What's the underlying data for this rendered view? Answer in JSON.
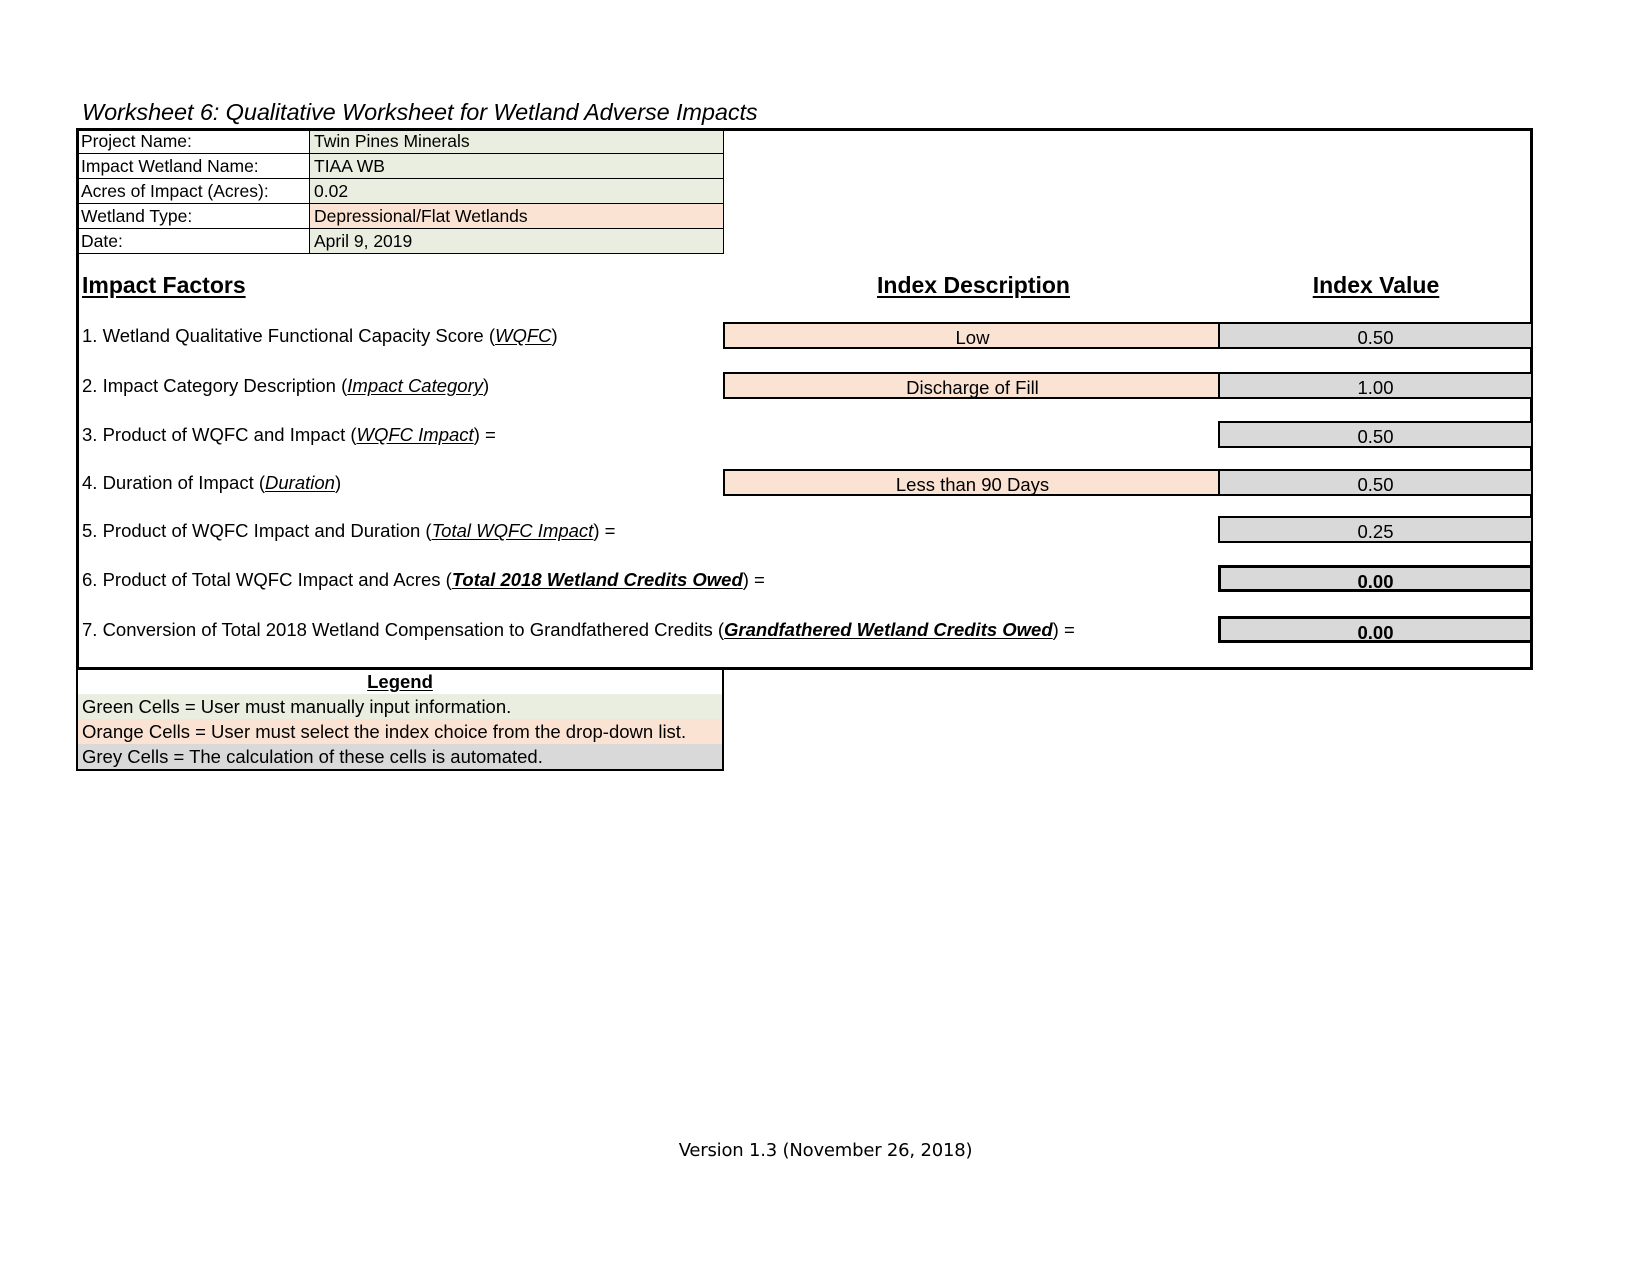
{
  "title": "Worksheet 6:  Qualitative Worksheet for Wetland Adverse Impacts",
  "project_info": {
    "rows": [
      {
        "label": "Project Name:",
        "value": "Twin Pines Minerals",
        "fill": "green"
      },
      {
        "label": "Impact Wetland Name:",
        "value": "TIAA WB",
        "fill": "green"
      },
      {
        "label": "Acres of Impact (Acres):",
        "value": "0.02",
        "fill": "green"
      },
      {
        "label": "Wetland Type:",
        "value": "Depressional/Flat Wetlands",
        "fill": "orange"
      },
      {
        "label": "Date:",
        "value": "April 9, 2019",
        "fill": "green"
      }
    ]
  },
  "headers": {
    "impact_factors": "Impact Factors",
    "index_description": "Index Description",
    "index_value": "Index Value"
  },
  "factors": [
    {
      "number": "1.",
      "text_before": "1. Wetland Qualitative Functional Capacity Score (",
      "term": "WQFC",
      "text_after": ")",
      "description": "Low",
      "value": "0.50",
      "has_description": true,
      "bold_value": false
    },
    {
      "number": "2.",
      "text_before": "2. Impact Category Description (",
      "term": "Impact Category",
      "text_after": ")",
      "description": "Discharge of Fill",
      "value": "1.00",
      "has_description": true,
      "bold_value": false
    },
    {
      "number": "3.",
      "text_before": "3. Product of WQFC and Impact (",
      "term": "WQFC Impact",
      "text_after": ") =",
      "description": "",
      "value": "0.50",
      "has_description": false,
      "bold_value": false
    },
    {
      "number": "4.",
      "text_before": "4. Duration of Impact (",
      "term": "Duration",
      "text_after": ")",
      "description": "Less than 90 Days",
      "value": "0.50",
      "has_description": true,
      "bold_value": false
    },
    {
      "number": "5.",
      "text_before": "5. Product of WQFC Impact and Duration (",
      "term": "Total WQFC Impact",
      "text_after": ") =",
      "description": "",
      "value": "0.25",
      "has_description": false,
      "bold_value": false
    },
    {
      "number": "6.",
      "text_before": "6. Product of Total WQFC Impact and Acres (",
      "term": "Total 2018 Wetland Credits Owed",
      "text_after": ") =",
      "description": "",
      "value": "0.00",
      "has_description": false,
      "bold_value": true
    },
    {
      "number": "7.",
      "text_before": "7. Conversion of Total 2018 Wetland Compensation to Grandfathered Credits (",
      "term": "Grandfathered Wetland Credits Owed",
      "text_after": ") =",
      "description": "",
      "value": "0.00",
      "has_description": false,
      "bold_value": true
    }
  ],
  "legend": {
    "title": "Legend",
    "rows": [
      {
        "text": "Green Cells = User must manually input information.",
        "fill": "green"
      },
      {
        "text": "Orange Cells = User must select the index choice from the drop-down list.",
        "fill": "orange"
      },
      {
        "text": "Grey Cells = The calculation of these cells is automated.",
        "fill": "grey"
      }
    ]
  },
  "footer": {
    "version": "Version 1.3 (November 26, 2018)"
  },
  "colors": {
    "green_fill": "#eaeee1",
    "orange_fill": "#fbe3d4",
    "grey_fill": "#d9d9d9",
    "border": "#000000"
  }
}
